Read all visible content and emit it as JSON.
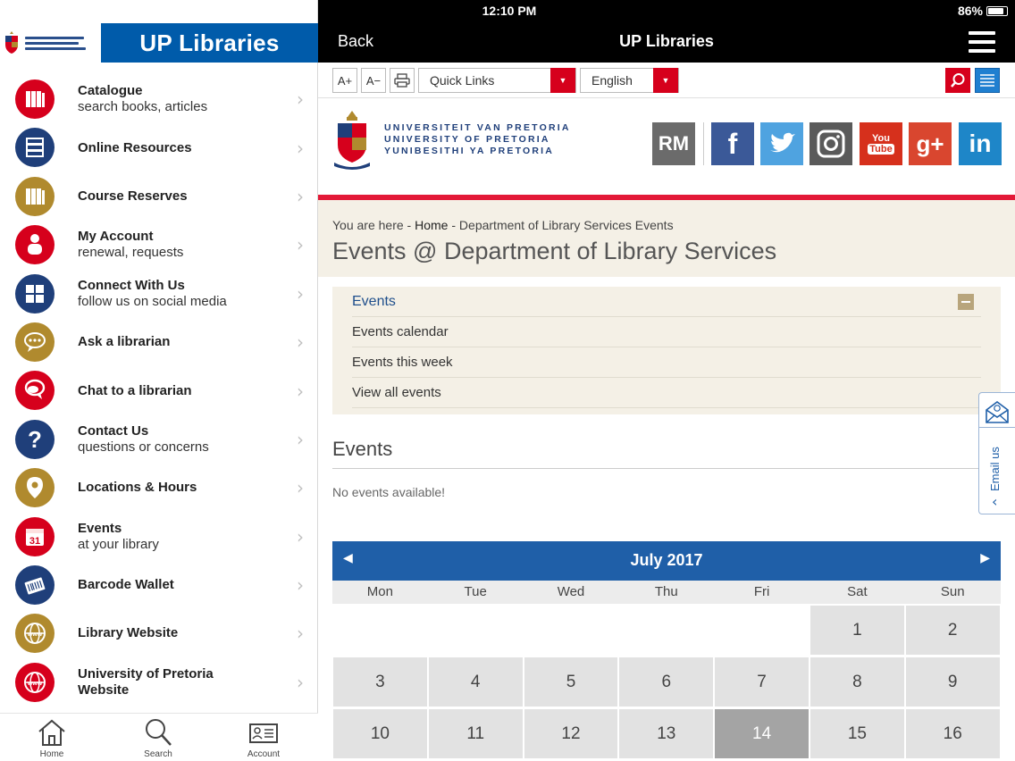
{
  "app": {
    "title": "UP Libraries",
    "logo_alt": "Universiteit van Pretoria"
  },
  "menu": [
    {
      "title": "Catalogue",
      "subtitle": "search books, articles",
      "icon": "books-icon",
      "color": "#d6001c"
    },
    {
      "title": "Online Resources",
      "subtitle": "",
      "icon": "server-icon",
      "color": "#1f3f7a"
    },
    {
      "title": "Course Reserves",
      "subtitle": "",
      "icon": "books-icon",
      "color": "#b08a2e"
    },
    {
      "title": "My Account",
      "subtitle": "renewal, requests",
      "icon": "person-icon",
      "color": "#d6001c"
    },
    {
      "title": "Connect With Us",
      "subtitle": "follow us on social media",
      "icon": "social-icon",
      "color": "#1f3f7a"
    },
    {
      "title": "Ask a librarian",
      "subtitle": "",
      "icon": "speech-bubble-icon",
      "color": "#b08a2e"
    },
    {
      "title": "Chat to a librarian",
      "subtitle": "",
      "icon": "chat-icon",
      "color": "#d6001c"
    },
    {
      "title": "Contact Us",
      "subtitle": "questions or concerns",
      "icon": "question-icon",
      "color": "#1f3f7a"
    },
    {
      "title": "Locations & Hours",
      "subtitle": "",
      "icon": "location-pin-icon",
      "color": "#b08a2e"
    },
    {
      "title": "Events",
      "subtitle": "at your library",
      "icon": "calendar-icon",
      "color": "#d6001c",
      "icon_text": "31"
    },
    {
      "title": "Barcode Wallet",
      "subtitle": "",
      "icon": "barcode-wallet-icon",
      "color": "#1f3f7a"
    },
    {
      "title": "Library Website",
      "subtitle": "",
      "icon": "globe-icon",
      "color": "#b08a2e"
    },
    {
      "title": "University of Pretoria Website",
      "subtitle": "",
      "icon": "globe-icon",
      "color": "#d6001c"
    }
  ],
  "tabbar": [
    {
      "label": "Home",
      "icon": "home-icon"
    },
    {
      "label": "Search",
      "icon": "search-icon"
    },
    {
      "label": "Account",
      "icon": "account-card-icon"
    }
  ],
  "status": {
    "time": "12:10 PM",
    "battery": "86%",
    "battery_level": 0.86
  },
  "nav": {
    "back": "Back",
    "title": "UP Libraries"
  },
  "toolbar": {
    "font_increase": "A+",
    "font_decrease": "A−",
    "quick_links": "Quick Links",
    "language": "English"
  },
  "site": {
    "uni_names": [
      "UNIVERSITEIT VAN PRETORIA",
      "UNIVERSITY OF PRETORIA",
      "YUNIBESITHI YA PRETORIA"
    ],
    "social": [
      {
        "name": "rm",
        "label": "RM",
        "color": "#6b6b6b"
      },
      {
        "name": "facebook",
        "label": "f",
        "color": "#3b5998"
      },
      {
        "name": "twitter",
        "label": "",
        "color": "#4fa3e0"
      },
      {
        "name": "instagram",
        "label": "",
        "color": "#5a5a5a"
      },
      {
        "name": "youtube",
        "label": "You Tube",
        "color": "#d6301c"
      },
      {
        "name": "google-plus",
        "label": "g+",
        "color": "#d9462f"
      },
      {
        "name": "linkedin",
        "label": "in",
        "color": "#1e86c8"
      }
    ]
  },
  "breadcrumb": {
    "prefix": "You are here - ",
    "home": "Home",
    "sep": " - ",
    "current": "Department of Library Services Events"
  },
  "page_title": "Events @ Department of Library Services",
  "subnav": {
    "heading": "Events",
    "items": [
      "Events calendar",
      "Events this week",
      "View all events"
    ]
  },
  "events": {
    "heading": "Events",
    "empty": "No events available!"
  },
  "email_tab": {
    "label": "Email us"
  },
  "calendar": {
    "month": "July 2017",
    "weekdays": [
      "Mon",
      "Tue",
      "Wed",
      "Thu",
      "Fri",
      "Sat",
      "Sun"
    ],
    "first_weekday_index": 5,
    "visible_days": [
      1,
      2,
      3,
      4,
      5,
      6,
      7,
      8,
      9,
      10,
      11,
      12,
      13,
      14,
      15,
      16
    ],
    "today": 14
  }
}
